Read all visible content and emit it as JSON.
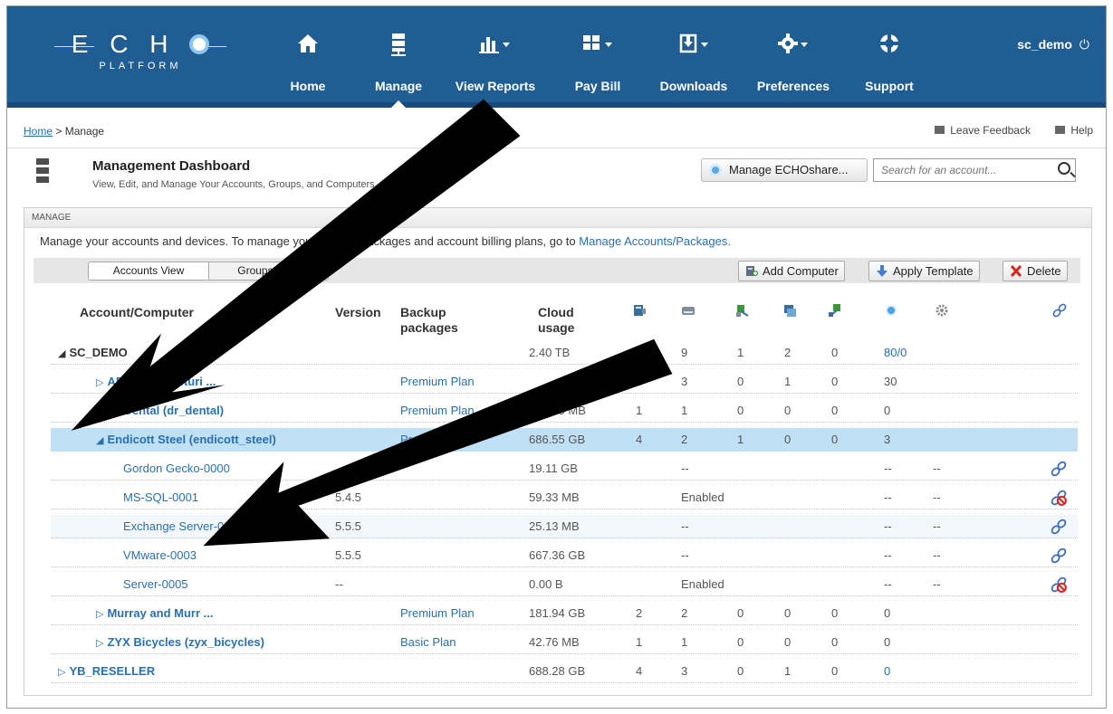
{
  "brand": {
    "echo": "ECHO",
    "platform": "PLATFORM"
  },
  "nav": [
    {
      "label": "Home",
      "icon": "home-icon"
    },
    {
      "label": "Manage",
      "icon": "server-icon"
    },
    {
      "label": "View Reports",
      "icon": "bar-chart-icon"
    },
    {
      "label": "Pay Bill",
      "icon": "grid-icon"
    },
    {
      "label": "Downloads",
      "icon": "download-icon"
    },
    {
      "label": "Preferences",
      "icon": "gear-icon"
    },
    {
      "label": "Support",
      "icon": "lifebuoy-icon"
    }
  ],
  "user": {
    "name": "sc_demo"
  },
  "breadcrumb": {
    "home": "Home",
    "sep": " > ",
    "current": "Manage"
  },
  "links": {
    "feedback": "Leave Feedback",
    "help": "Help"
  },
  "header": {
    "title": "Management Dashboard",
    "subtitle": "View, Edit, and Manage Your Accounts, Groups, and Computers"
  },
  "share_button": "Manage ECHOshare...",
  "search": {
    "placeholder": "Search for an account..."
  },
  "panel": {
    "title": "MANAGE",
    "intro": "Manage your accounts and devices. To manage your backup packages and account billing plans, go to ",
    "intro_link": "Manage Accounts/Packages."
  },
  "toolbar": {
    "views": [
      "Accounts View",
      "Groups View"
    ],
    "add": "Add Computer",
    "apply": "Apply Template",
    "delete": "Delete"
  },
  "columns": {
    "account": "Account/Computer",
    "version": "Version",
    "backup": "Backup packages",
    "cloud": "Cloud usage"
  },
  "rows": [
    {
      "name": "SC_DEMO",
      "level": 0,
      "tri": "◢",
      "version": "",
      "plan": "",
      "cloud": "2.40 TB",
      "c1": "",
      "c2": "9",
      "c3": "1",
      "c4": "2",
      "c5": "0",
      "c6": "80/0",
      "c7": "",
      "link": ""
    },
    {
      "name": "ABC Manufacturi ...",
      "level": 1,
      "tri": "▷",
      "version": "",
      "plan": "Premium Plan",
      "cloud": "",
      "c1": "3",
      "c2": "3",
      "c3": "0",
      "c4": "1",
      "c5": "0",
      "c6": "30",
      "c7": "",
      "link": ""
    },
    {
      "name": "Dr Dental (dr_dental)",
      "level": 1,
      "tri": "▷",
      "version": "",
      "plan": "Premium Plan",
      "cloud": "739.40 MB",
      "c1": "1",
      "c2": "1",
      "c3": "0",
      "c4": "0",
      "c5": "0",
      "c6": "0",
      "c7": "",
      "link": ""
    },
    {
      "name": "Endicott Steel (endicott_steel)",
      "level": 1,
      "tri": "◢",
      "version": "",
      "plan": "Premium Plan",
      "cloud": "686.55 GB",
      "c1": "4",
      "c2": "2",
      "c3": "1",
      "c4": "0",
      "c5": "0",
      "c6": "3",
      "c7": "",
      "link": ""
    },
    {
      "name": "Gordon Gecko-0000",
      "level": 2,
      "tri": "",
      "version": "",
      "plan": "",
      "cloud": "19.11 GB",
      "c1": "",
      "c2": "--",
      "c3": "",
      "c4": "",
      "c5": "",
      "c6": "--",
      "c7": "--",
      "link": "link"
    },
    {
      "name": "MS-SQL-0001",
      "level": 2,
      "tri": "",
      "version": "5.4.5",
      "plan": "",
      "cloud": "59.33 MB",
      "c1": "",
      "c2": "Enabled",
      "c3": "",
      "c4": "",
      "c5": "",
      "c6": "--",
      "c7": "--",
      "link": "broken"
    },
    {
      "name": "Exchange Server-0002",
      "level": 2,
      "tri": "",
      "version": "5.5.5",
      "plan": "",
      "cloud": "25.13 MB",
      "c1": "",
      "c2": "--",
      "c3": "",
      "c4": "",
      "c5": "",
      "c6": "--",
      "c7": "--",
      "link": "link"
    },
    {
      "name": "VMware-0003",
      "level": 2,
      "tri": "",
      "version": "5.5.5",
      "plan": "",
      "cloud": "667.36 GB",
      "c1": "",
      "c2": "--",
      "c3": "",
      "c4": "",
      "c5": "",
      "c6": "--",
      "c7": "--",
      "link": "link"
    },
    {
      "name": "Server-0005",
      "level": 2,
      "tri": "",
      "version": "--",
      "plan": "",
      "cloud": "0.00 B",
      "c1": "",
      "c2": "Enabled",
      "c3": "",
      "c4": "",
      "c5": "",
      "c6": "--",
      "c7": "--",
      "link": "broken"
    },
    {
      "name": "Murray and Murr ...",
      "level": 1,
      "tri": "▷",
      "version": "",
      "plan": "Premium Plan",
      "cloud": "181.94 GB",
      "c1": "2",
      "c2": "2",
      "c3": "0",
      "c4": "0",
      "c5": "0",
      "c6": "0",
      "c7": "",
      "link": ""
    },
    {
      "name": "ZYX Bicycles (zyx_bicycles)",
      "level": 1,
      "tri": "▷",
      "version": "",
      "plan": "Basic Plan",
      "cloud": "42.76 MB",
      "c1": "1",
      "c2": "1",
      "c3": "0",
      "c4": "0",
      "c5": "0",
      "c6": "0",
      "c7": "",
      "link": ""
    },
    {
      "name": "YB_RESELLER",
      "level": 0,
      "tri": "▷",
      "version": "",
      "plan": "",
      "cloud": "688.28 GB",
      "c1": "4",
      "c2": "3",
      "c3": "0",
      "c4": "1",
      "c5": "0",
      "c6": "0",
      "c7": "",
      "link": ""
    }
  ],
  "colors": {
    "nav_bg": "#1f5d92",
    "link": "#2a6fb0",
    "selected_row": "#bfe0f5",
    "delete_x": "#d9261c",
    "broken_link": "#e02020"
  }
}
